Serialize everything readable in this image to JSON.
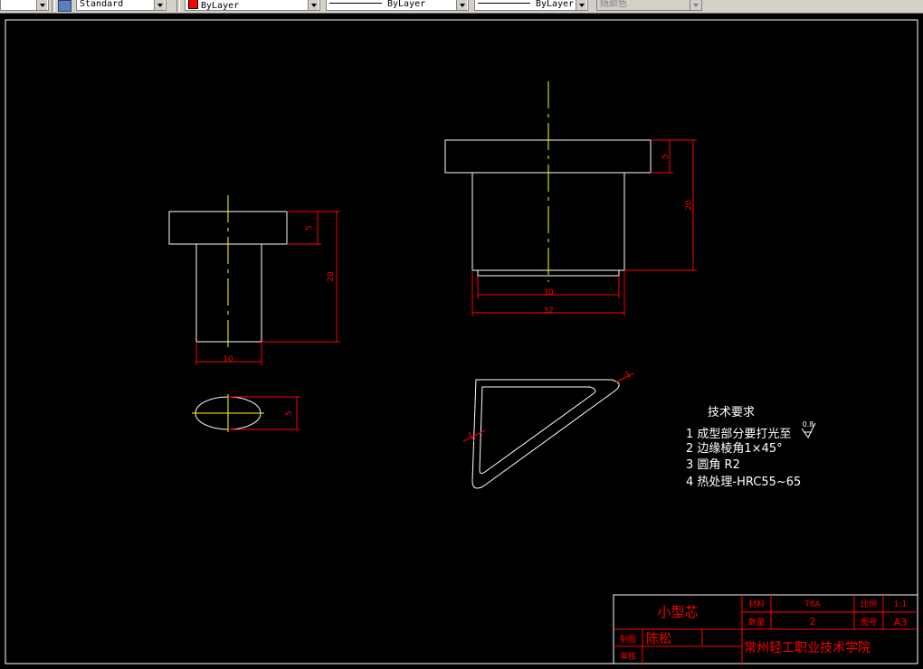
{
  "toolbar": {
    "text_style": "Standard",
    "color": "ByLayer",
    "linetype": "ByLayer",
    "lineweight": "ByLayer",
    "plot_style": "随颜色",
    "color_swatch": "#ff0000"
  },
  "drawing": {
    "dims": {
      "small_flange_thickness": "5",
      "small_total_height": "20",
      "small_shaft_width": "10",
      "ellipse_height": "5",
      "large_flange_thickness": "5",
      "large_total_height": "20",
      "large_inner_width": "30",
      "large_outer_width": "32"
    },
    "tech_requirements": {
      "title": "技术要求",
      "items": [
        "1 成型部分要打光至",
        "2 边缘棱角1×45°",
        "3 圆角 R2",
        "4 热处理-HRC55~65"
      ],
      "roughness_value": "0.8"
    },
    "title_block": {
      "part_name": "小型芯",
      "material_label": "材料",
      "material_value": "T8A",
      "scale_label": "比例",
      "scale_value": "1:1",
      "quantity_label": "数量",
      "quantity_value": "2",
      "sheet_label": "图号",
      "sheet_value": "A3",
      "drawn_label": "制图",
      "drawn_by": "陈松",
      "checked_label": "审核",
      "school": "常州轻工职业技术学院"
    },
    "colors": {
      "geometry": "#ffffff",
      "dimension": "#ff0000",
      "centerline": "#ffff00",
      "frame": "#ffffff"
    }
  }
}
